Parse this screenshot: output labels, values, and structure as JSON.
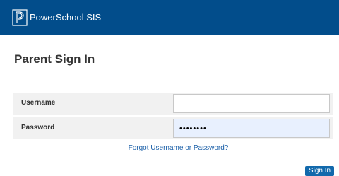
{
  "header": {
    "brand": "PowerSchool SIS",
    "logo_icon": "powerschool-logo-icon",
    "background_color": "#024d8b"
  },
  "page": {
    "title": "Parent Sign In"
  },
  "form": {
    "username": {
      "label": "Username",
      "value": ""
    },
    "password": {
      "label": "Password",
      "value": "••••••••"
    },
    "forgot_link": "Forgot Username or Password?",
    "submit_label": "Sign In"
  },
  "colors": {
    "accent": "#1269ac",
    "link": "#1a5fa8"
  }
}
